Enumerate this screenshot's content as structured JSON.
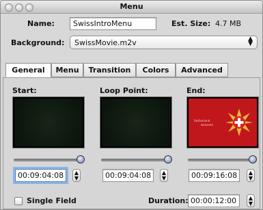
{
  "window": {
    "title": "Menu"
  },
  "form": {
    "name_label": "Name:",
    "name_value": "SwissIntroMenu",
    "est_size_label": "Est. Size:",
    "est_size_value": "4.7 MB",
    "background_label": "Background:",
    "background_value": "SwissMovie.m2v"
  },
  "tabs": [
    {
      "label": "General",
      "active": true
    },
    {
      "label": "Menu",
      "active": false
    },
    {
      "label": "Transition",
      "active": false
    },
    {
      "label": "Colors",
      "active": false
    },
    {
      "label": "Advanced",
      "active": false
    }
  ],
  "points": {
    "start": {
      "label": "Start:",
      "timecode": "00:09:04:08",
      "slider_value": 1.0,
      "preview": "dark"
    },
    "loop": {
      "label": "Loop Point:",
      "timecode": "00:09:04:08",
      "slider_value": 1.0,
      "preview": "dark"
    },
    "end": {
      "label": "End:",
      "timecode": "00:09:16:08",
      "slider_value": 1.0,
      "preview": "swiss-logo",
      "preview_text_line1": "Switzerland",
      "preview_text_line2": "welcome"
    }
  },
  "footer": {
    "single_field_label": "Single Field",
    "single_field_checked": false,
    "duration_label": "Duration:",
    "duration_value": "00:00:12:00"
  },
  "colors": {
    "preview_red": "#c0171c",
    "preview_dark": "#0f1a10",
    "focus_ring": "#8fb3e6"
  }
}
